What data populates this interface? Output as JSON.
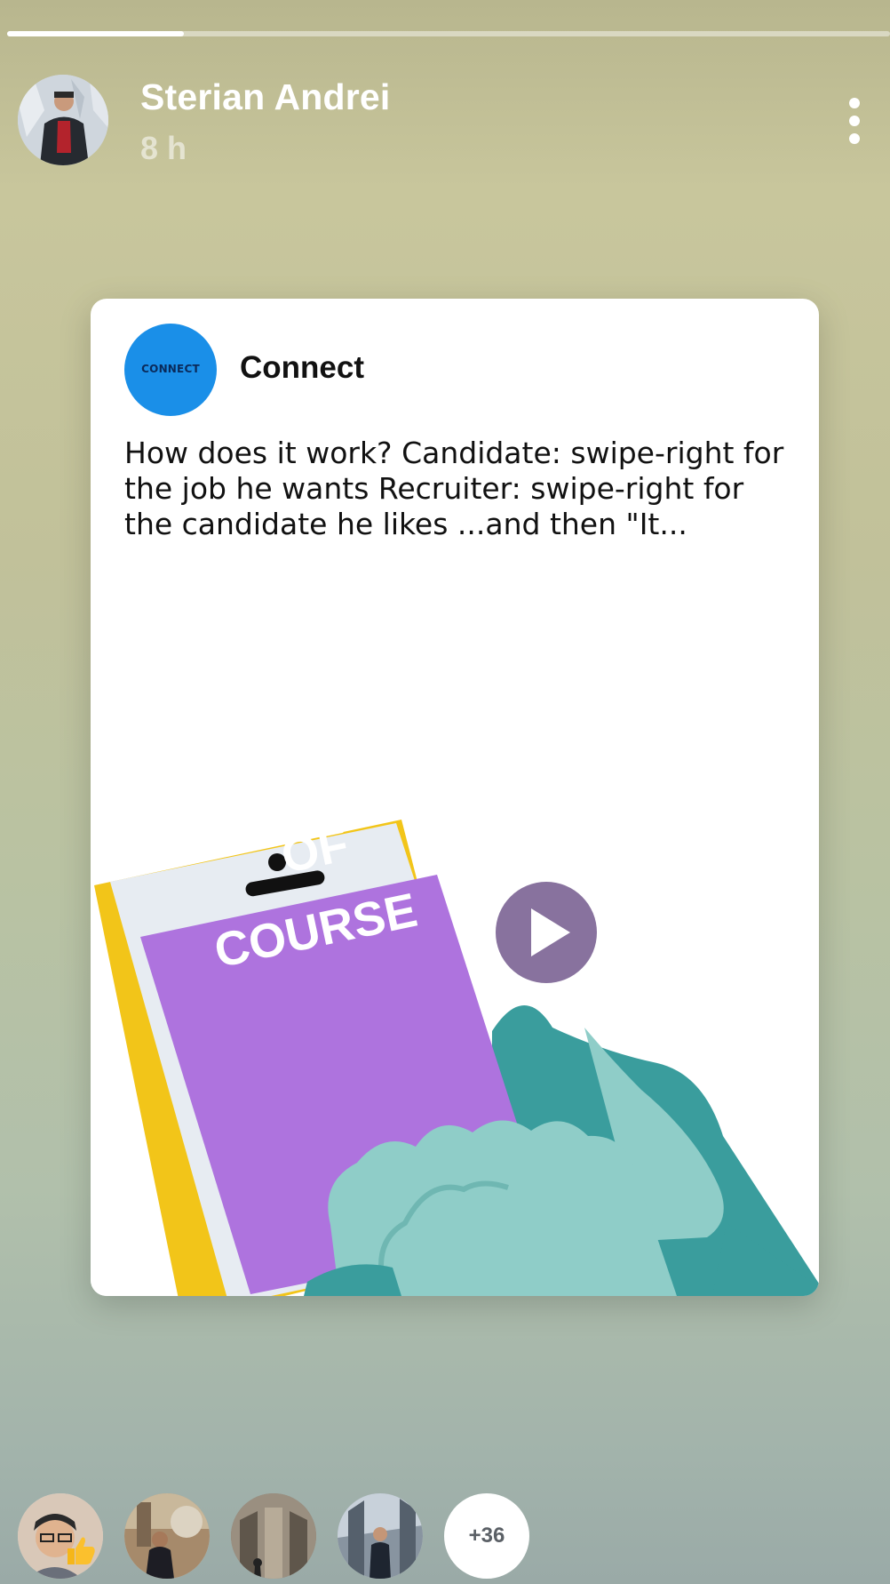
{
  "story": {
    "progress": 0.2,
    "author": {
      "name": "Sterian Andrei",
      "time_ago": "8 h"
    }
  },
  "post": {
    "page_name": "Connect",
    "logo_text": "CONNECT",
    "text": "How does it work? Candidate: swipe-right for the job he wants Recruiter: swipe-right for the candidate he likes ...and then \"It...",
    "image_text": {
      "line1": "OF",
      "line2": "COURSE"
    }
  },
  "viewers": {
    "more_count": "+36"
  },
  "colors": {
    "progress": "#ffffff",
    "logo": "#1a8fe8",
    "screen": "#ae73de",
    "phone_outline": "#f2c519",
    "hand_dark": "#3a9d9d",
    "hand_light": "#8fcdc8",
    "play_button": "#5a3c78"
  },
  "icons": [
    "more-vertical-icon",
    "play-icon",
    "thumbs-up-icon"
  ]
}
